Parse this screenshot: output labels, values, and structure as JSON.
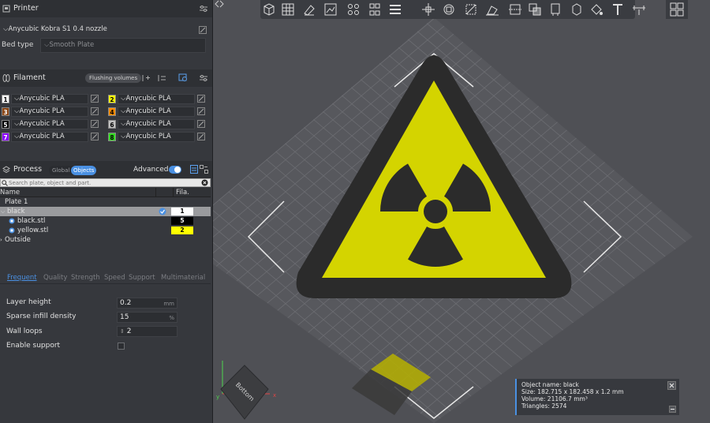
{
  "printer": {
    "section_title": "Printer",
    "preset": "Anycubic Kobra S1 0.4 nozzle",
    "bed_type_label": "Bed type",
    "bed_type_value": "Smooth Plate"
  },
  "filament": {
    "section_title": "Filament",
    "flushing_button": "Flushing volumes",
    "slots": [
      {
        "num": "1",
        "name": "Anycubic PLA",
        "color": "#ffffff",
        "text_color": "#000000"
      },
      {
        "num": "2",
        "name": "Anycubic PLA",
        "color": "#ffff00",
        "text_color": "#000000"
      },
      {
        "num": "3",
        "name": "Anycubic PLA",
        "color": "#8b4513",
        "text_color": "#ffffff"
      },
      {
        "num": "4",
        "name": "Anycubic PLA",
        "color": "#ff8c00",
        "text_color": "#000000"
      },
      {
        "num": "5",
        "name": "Anycubic PLA",
        "color": "#000000",
        "text_color": "#ffffff"
      },
      {
        "num": "6",
        "name": "Anycubic PLA",
        "color": "#c0c0c0",
        "text_color": "#000000"
      },
      {
        "num": "7",
        "name": "Anycubic PLA",
        "color": "#8b00ff",
        "text_color": "#ffffff"
      },
      {
        "num": "8",
        "name": "Anycubic PLA",
        "color": "#33dd22",
        "text_color": "#000000"
      }
    ]
  },
  "process": {
    "section_title": "Process",
    "toggle_global": "Global",
    "toggle_objects": "Objects",
    "advanced_label": "Advanced",
    "search_placeholder": "Search plate, object and part.",
    "col_name": "Name",
    "col_fila": "Fila.",
    "tree": {
      "plate": "Plate 1",
      "object": "black",
      "object_fila": "1",
      "parts": [
        {
          "name": "black.stl",
          "fila": "5",
          "fila_color": "#000000",
          "fila_text": "#ffffff"
        },
        {
          "name": "yellow.stl",
          "fila": "2",
          "fila_color": "#ffff00",
          "fila_text": "#000000"
        }
      ],
      "outside": "Outside"
    },
    "tabs": [
      "Frequent",
      "Quality",
      "Strength",
      "Speed",
      "Support",
      "Multimaterial"
    ],
    "params": {
      "layer_height": {
        "label": "Layer height",
        "value": "0.2",
        "unit": "mm"
      },
      "sparse_infill": {
        "label": "Sparse infill density",
        "value": "15",
        "unit": "%"
      },
      "wall_loops": {
        "label": "Wall loops",
        "value": "2"
      },
      "enable_support": {
        "label": "Enable support"
      }
    }
  },
  "viewport": {
    "view_cube_label": "Bottom",
    "axis_x": "x",
    "axis_y": "y",
    "info": {
      "object_name": "Object name: black",
      "size": "Size: 182.715 x 182.458 x 1.2 mm",
      "volume": "Volume: 21106.7 mm³",
      "triangles": "Triangles: 2574"
    }
  },
  "colors": {
    "accent": "#4a90e2",
    "sign_yellow": "#d4d400",
    "sign_dark": "#2b2b2b",
    "bed_grid": "#6a6b70"
  }
}
